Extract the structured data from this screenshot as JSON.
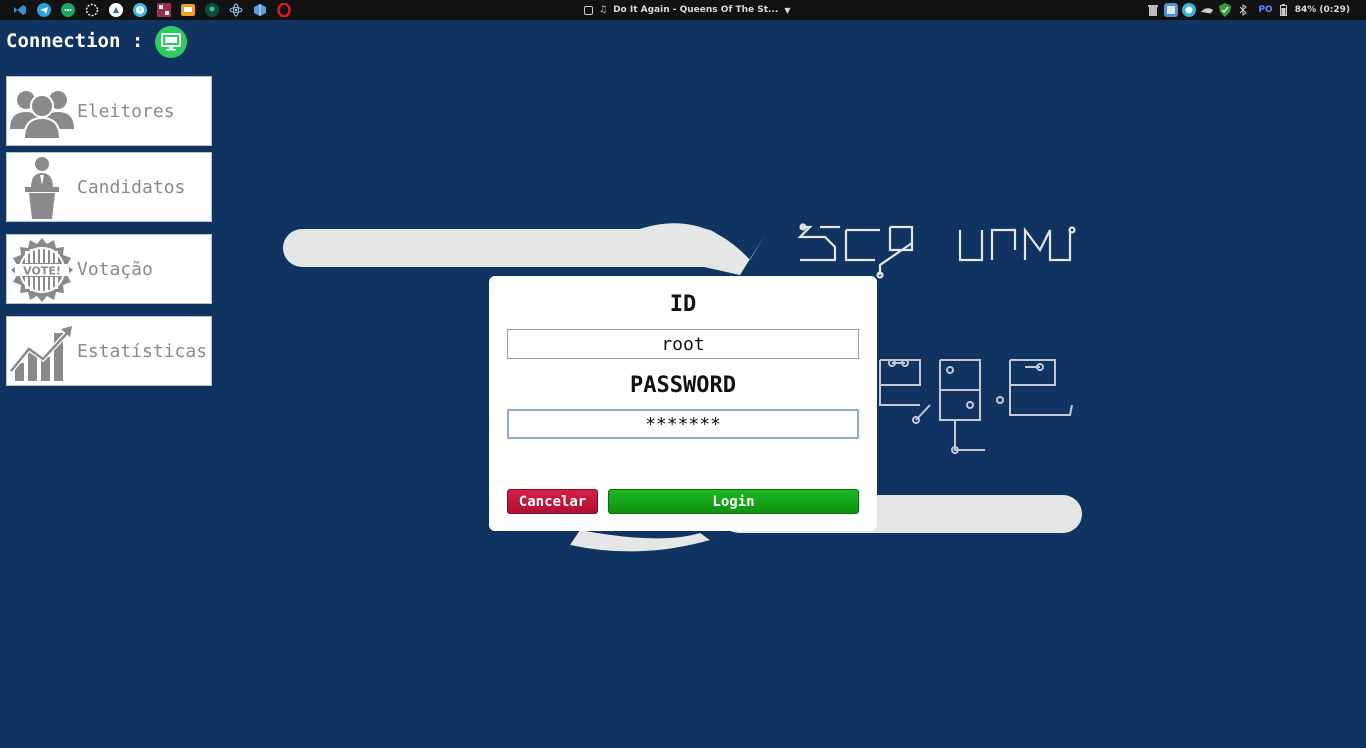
{
  "taskbar": {
    "media_title": "Do It Again - Queens Of The St...",
    "keyboard_layout": "PO",
    "battery": "84% (0:29)"
  },
  "connection": {
    "label": "Connection :",
    "status_color": "#2ecc5f"
  },
  "menu": [
    {
      "label": "Eleitores",
      "icon": "voters-group-icon"
    },
    {
      "label": "Candidatos",
      "icon": "candidate-podium-icon"
    },
    {
      "label": "Votação",
      "icon": "vote-seal-icon"
    },
    {
      "label": "Estatísticas",
      "icon": "statistics-chart-icon"
    }
  ],
  "login": {
    "id_label": "ID",
    "id_value": "root",
    "password_label": "PASSWORD",
    "password_value": "*******",
    "cancel_label": "Cancelar",
    "login_label": "Login"
  },
  "colors": {
    "background": "#0f3461",
    "cancel": "#c41840",
    "login": "#14a818"
  }
}
